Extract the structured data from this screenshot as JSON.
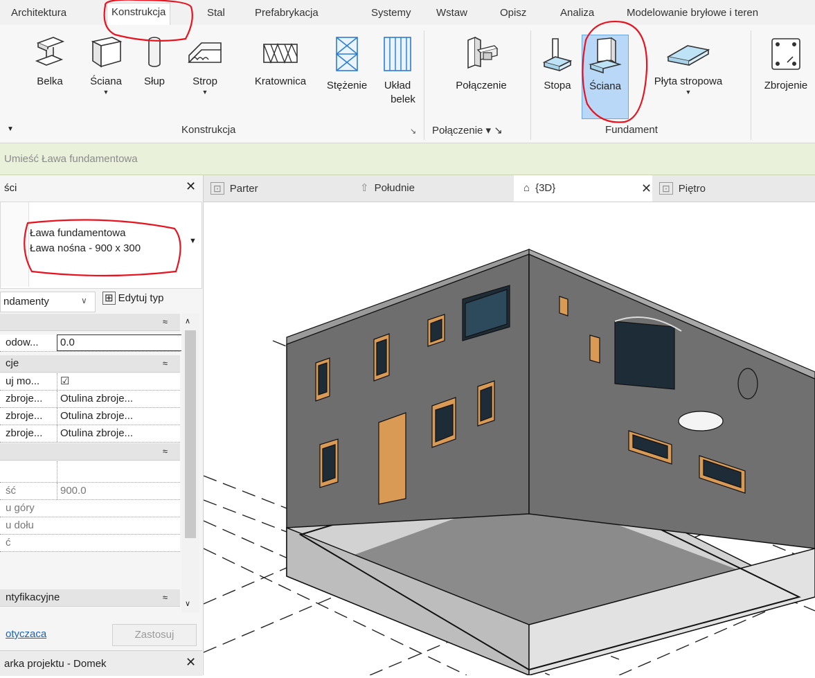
{
  "ribbon_tabs": [
    "Architektura",
    "Konstrukcja",
    "Stal",
    "Prefabrykacja",
    "Systemy",
    "Wstaw",
    "Opisz",
    "Analiza",
    "Modelowanie bryłowe i teren"
  ],
  "tools": {
    "beam": "Belka",
    "wall": "Ściana",
    "column": "Słup",
    "floor": "Strop",
    "truss": "Kratownica",
    "brace": "Stężenie",
    "beam_system_1": "Układ",
    "beam_system_2": "belek",
    "connection": "Połączenie",
    "isolated": "Stopa",
    "wall_foundation": "Ściana",
    "slab": "Płyta stropowa",
    "rebar": "Zbrojenie"
  },
  "panels": {
    "structure": "Konstrukcja",
    "connection": "Połączenie ▾ ↘",
    "foundation": "Fundament"
  },
  "option_bar": "Umieść Ława fundamentowa",
  "properties": {
    "title": "ści",
    "type_family": "Ława fundamentowa",
    "type_name": "Ława nośna - 900 x 300",
    "category_filter": "ndamenty",
    "edit_type": "Edytuj typ",
    "rows": [
      {
        "kind": "cat",
        "label": ""
      },
      {
        "kind": "prop",
        "key": "odow...",
        "value": "0.0"
      },
      {
        "kind": "cat",
        "label": "cje"
      },
      {
        "kind": "prop",
        "key": "uj mo...",
        "value": "☑"
      },
      {
        "kind": "prop",
        "key": "zbroje...",
        "value": "Otulina zbroje..."
      },
      {
        "kind": "prop",
        "key": "zbroje...",
        "value": "Otulina zbroje..."
      },
      {
        "kind": "prop",
        "key": "zbroje...",
        "value": "Otulina zbroje..."
      },
      {
        "kind": "cat",
        "label": ""
      },
      {
        "kind": "prop",
        "key": "",
        "value": ""
      },
      {
        "kind": "prop",
        "key": "ść",
        "value": "900.0"
      },
      {
        "kind": "prop",
        "key": "u góry",
        "value": ""
      },
      {
        "kind": "prop",
        "key": "u dołu",
        "value": ""
      },
      {
        "kind": "prop",
        "key": "ć",
        "value": ""
      },
      {
        "kind": "cat",
        "label": "ntyfikacyjne"
      }
    ],
    "help_link": "otyczaca",
    "apply_button": "Zastosuj",
    "browser_title": "arka projektu - Domek"
  },
  "view_tabs": [
    "Parter",
    "Południe",
    "{3D}",
    "Piętro"
  ],
  "colors": {
    "annotation_red": "#e8131f",
    "selected_tool_bg": "#b9d7f6",
    "option_bar_bg": "#e9f1db",
    "wall_gray": "#6e6e6e",
    "door_orange": "#d89a55"
  }
}
